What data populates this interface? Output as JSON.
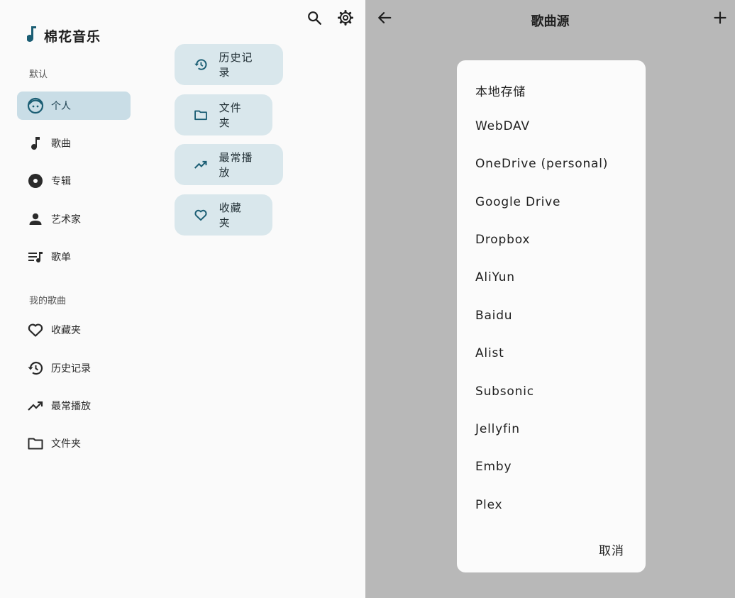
{
  "app": {
    "title": "棉花音乐"
  },
  "sidebar": {
    "section_default": "默认",
    "section_my": "我的歌曲",
    "items": [
      {
        "label": "个人",
        "icon": "face-icon",
        "active": true
      },
      {
        "label": "歌曲",
        "icon": "music-note-icon"
      },
      {
        "label": "专辑",
        "icon": "album-icon"
      },
      {
        "label": "艺术家",
        "icon": "person-icon"
      },
      {
        "label": "歌单",
        "icon": "playlist-icon"
      },
      {
        "label": "收藏夹",
        "icon": "heart-icon"
      },
      {
        "label": "历史记录",
        "icon": "history-icon"
      },
      {
        "label": "最常播放",
        "icon": "trending-up-icon"
      },
      {
        "label": "文件夹",
        "icon": "folder-icon"
      }
    ]
  },
  "chips": [
    {
      "label": "历史记录",
      "icon": "history-icon"
    },
    {
      "label": "文件夹",
      "icon": "folder-icon"
    },
    {
      "label": "最常播放",
      "icon": "trending-up-icon"
    },
    {
      "label": "收藏夹",
      "icon": "heart-icon"
    }
  ],
  "right": {
    "title": "歌曲源",
    "dialog": {
      "options": [
        "本地存储",
        "WebDAV",
        "OneDrive (personal)",
        "Google Drive",
        "Dropbox",
        "AliYun",
        "Baidu",
        "Alist",
        "Subsonic",
        "Jellyfin",
        "Emby",
        "Plex"
      ],
      "cancel": "取消"
    }
  },
  "colors": {
    "accent": "#1b5e74",
    "active_bg": "#c9dde6",
    "chip_bg": "#d9e7ec",
    "scrim": "#b8b8b8"
  }
}
